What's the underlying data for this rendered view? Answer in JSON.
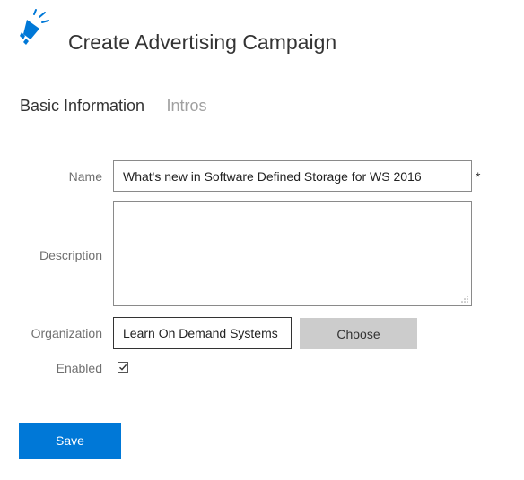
{
  "header": {
    "icon": "megaphone-icon",
    "title": "Create Advertising Campaign",
    "accent_color": "#0078d7"
  },
  "tabs": [
    {
      "label": "Basic Information",
      "active": true
    },
    {
      "label": "Intros",
      "active": false
    }
  ],
  "form": {
    "name": {
      "label": "Name",
      "value": "What's new in Software Defined Storage for WS 2016",
      "required_mark": "*"
    },
    "description": {
      "label": "Description",
      "value": ""
    },
    "organization": {
      "label": "Organization",
      "value": "Learn On Demand Systems",
      "choose_label": "Choose"
    },
    "enabled": {
      "label": "Enabled",
      "checked": true
    }
  },
  "actions": {
    "save_label": "Save",
    "save_color": "#0078d7"
  }
}
